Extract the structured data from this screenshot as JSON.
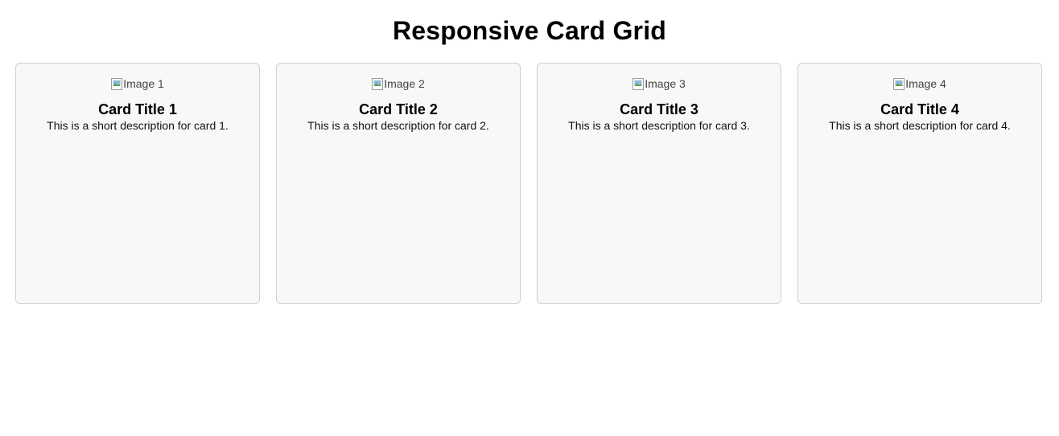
{
  "page": {
    "title": "Responsive Card Grid"
  },
  "cards": [
    {
      "image_alt": "Image 1",
      "title": "Card Title 1",
      "description": "This is a short description for card 1."
    },
    {
      "image_alt": "Image 2",
      "title": "Card Title 2",
      "description": "This is a short description for card 2."
    },
    {
      "image_alt": "Image 3",
      "title": "Card Title 3",
      "description": "This is a short description for card 3."
    },
    {
      "image_alt": "Image 4",
      "title": "Card Title 4",
      "description": "This is a short description for card 4."
    }
  ],
  "icons": {
    "card_image": "broken-image-icon"
  },
  "colors": {
    "card_background": "#f8f8f8",
    "card_border": "#d0d0d0"
  }
}
